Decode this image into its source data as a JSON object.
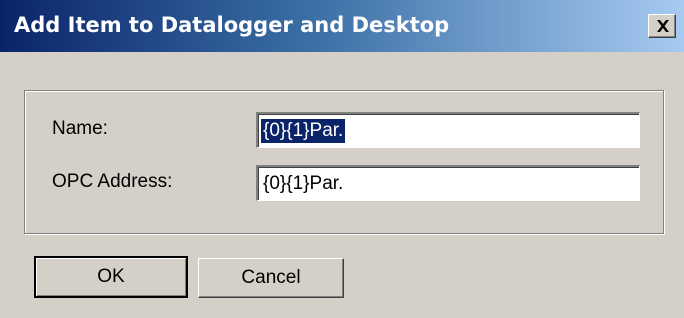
{
  "window": {
    "title": "Add Item to Datalogger and Desktop",
    "close_icon": "close-icon"
  },
  "form": {
    "name_label": "Name:",
    "name_value": "{0}{1}Par.",
    "opc_label": "OPC Address:",
    "opc_value": "{0}{1}Par."
  },
  "buttons": {
    "ok_label": "OK",
    "cancel_label": "Cancel"
  },
  "colors": {
    "titlebar_start": "#0a246a",
    "titlebar_end": "#a6caf0",
    "dialog_bg": "#d4d0c8",
    "selection": "#0a246a"
  }
}
